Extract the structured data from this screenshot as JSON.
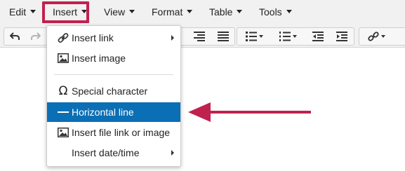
{
  "menubar": {
    "items": [
      {
        "label": "Edit"
      },
      {
        "label": "Insert"
      },
      {
        "label": "View"
      },
      {
        "label": "Format"
      },
      {
        "label": "Table"
      },
      {
        "label": "Tools"
      }
    ]
  },
  "toolbar": {
    "buttons": [
      {
        "icon": "undo-icon",
        "enabled": true
      },
      {
        "icon": "redo-icon",
        "enabled": false
      },
      {
        "icon": "align-right-icon",
        "enabled": true
      },
      {
        "icon": "align-justify-icon",
        "enabled": true
      },
      {
        "icon": "bullet-list-icon",
        "enabled": true
      },
      {
        "icon": "numbered-list-icon",
        "enabled": true
      },
      {
        "icon": "outdent-icon",
        "enabled": true
      },
      {
        "icon": "indent-icon",
        "enabled": true
      },
      {
        "icon": "link-icon",
        "enabled": true
      }
    ]
  },
  "insert_menu": {
    "items": [
      {
        "label": "Insert link",
        "icon": "link-icon",
        "has_submenu": true
      },
      {
        "label": "Insert image",
        "icon": "image-icon",
        "has_submenu": false
      },
      {
        "label": "Special character",
        "icon": "omega-icon",
        "has_submenu": false
      },
      {
        "label": "Horizontal line",
        "icon": "horizontal-line-icon",
        "has_submenu": false,
        "active": true
      },
      {
        "label": "Insert file link or image",
        "icon": "image-icon",
        "has_submenu": false
      },
      {
        "label": "Insert date/time",
        "icon": "",
        "has_submenu": true
      }
    ]
  },
  "annotation": {
    "highlight_color": "#c0224f",
    "active_color": "#0b6fb5"
  }
}
